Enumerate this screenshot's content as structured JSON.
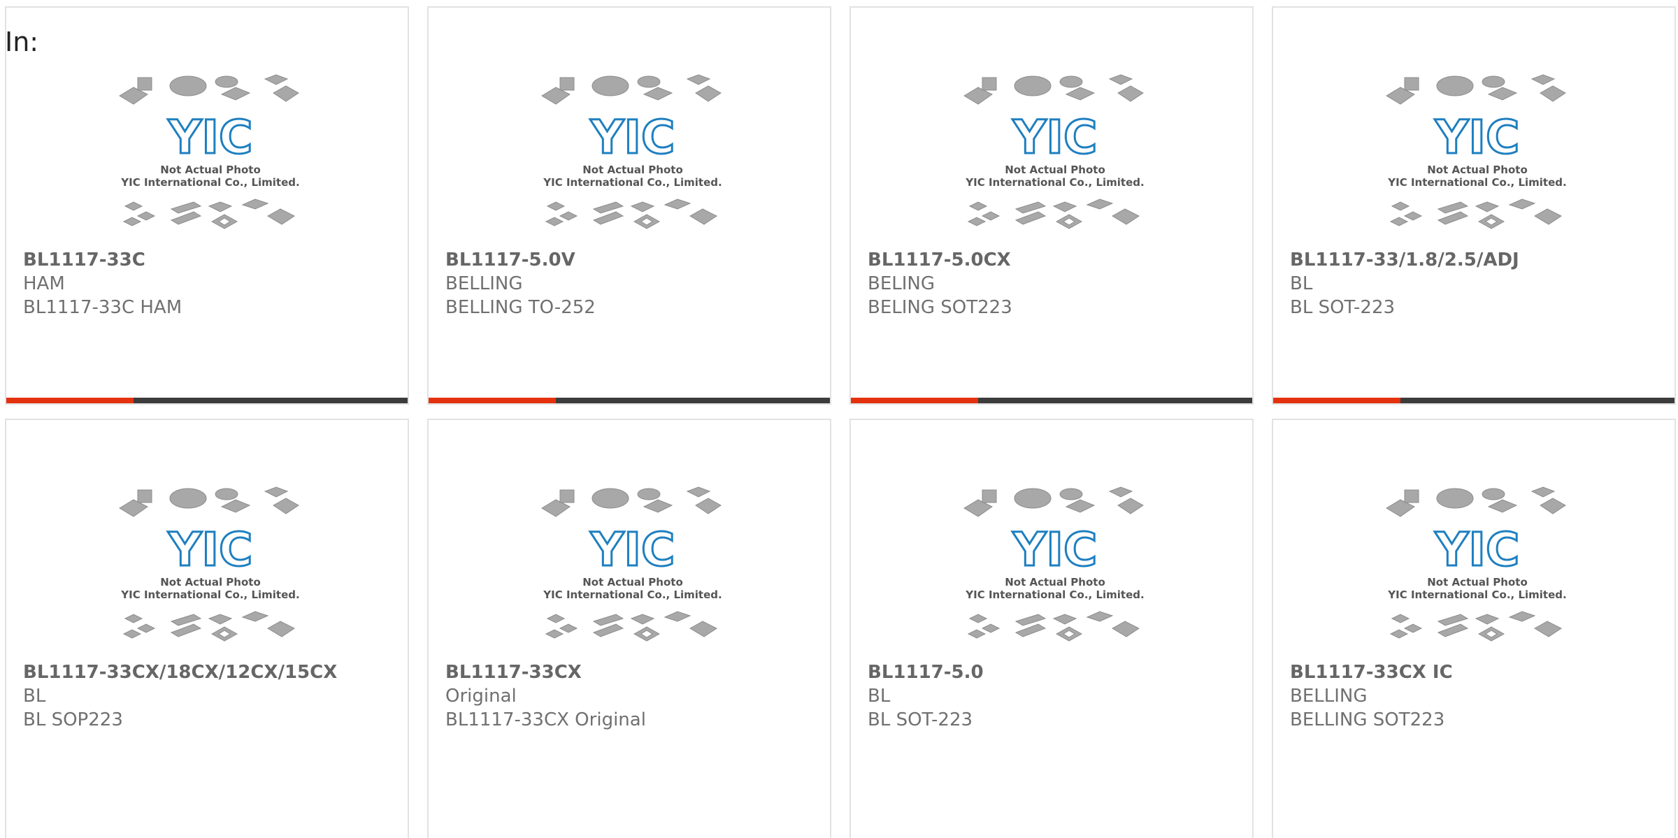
{
  "header": {
    "in_label": "In:"
  },
  "colors": {
    "accent": "#e5320e",
    "bar": "#3c3c3c",
    "logo_blue": "#1e7fc0",
    "chip_gray": "#a8a8a8"
  },
  "placeholder": {
    "line1": "Not Actual Photo",
    "line2": "YIC International Co., Limited.",
    "logo_text": "YIC"
  },
  "products": [
    {
      "part": "BL1117-33C",
      "manufacturer": "HAM",
      "description": "BL1117-33C HAM"
    },
    {
      "part": "BL1117-5.0V",
      "manufacturer": "BELLING",
      "description": "BELLING TO-252"
    },
    {
      "part": "BL1117-5.0CX",
      "manufacturer": "BELING",
      "description": "BELING SOT223"
    },
    {
      "part": "BL1117-33/1.8/2.5/ADJ",
      "manufacturer": "BL",
      "description": "BL SOT-223"
    },
    {
      "part": "BL1117-33CX/18CX/12CX/15CX",
      "manufacturer": "BL",
      "description": "BL SOP223"
    },
    {
      "part": "BL1117-33CX",
      "manufacturer": "Original",
      "description": "BL1117-33CX Original"
    },
    {
      "part": "BL1117-5.0",
      "manufacturer": "BL",
      "description": "BL SOT-223"
    },
    {
      "part": "BL1117-33CX IC",
      "manufacturer": "BELLING",
      "description": "BELLING SOT223"
    }
  ]
}
